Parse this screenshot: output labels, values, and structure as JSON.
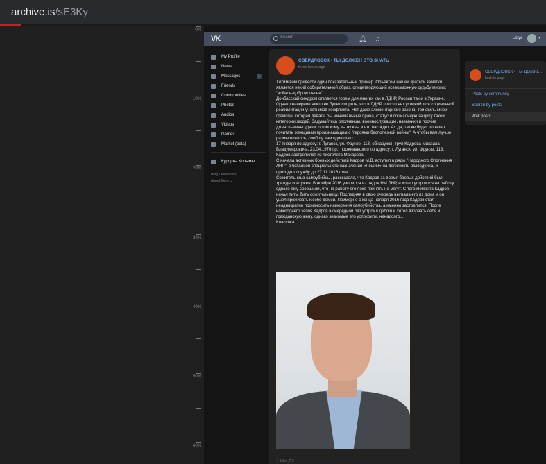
{
  "browser": {
    "url_host": "archive.is",
    "url_path": "/sE3Ky"
  },
  "ruler": {
    "labels": [
      "0%",
      "10%",
      "20%",
      "30%",
      "40%",
      "50%",
      "60%"
    ]
  },
  "vk": {
    "search_placeholder": "Search",
    "user_name": "Lidya",
    "sidebar": [
      {
        "label": "My Profile",
        "icon": "home-icon"
      },
      {
        "label": "News",
        "icon": "news-icon"
      },
      {
        "label": "Messages",
        "icon": "chat-icon",
        "badge": "1"
      },
      {
        "label": "Friends",
        "icon": "friends-icon"
      },
      {
        "label": "Communities",
        "icon": "communities-icon"
      },
      {
        "label": "Photos",
        "icon": "camera-icon"
      },
      {
        "label": "Audios",
        "icon": "music-icon"
      },
      {
        "label": "Videos",
        "icon": "video-icon"
      },
      {
        "label": "Games",
        "icon": "games-icon"
      },
      {
        "label": "Market (beta)",
        "icon": "shop-icon"
      }
    ],
    "sidebar_community": "Курорты Колымы",
    "sidebar_footer_1": "Blog   Developers",
    "sidebar_footer_2": "About   More ⌄",
    "post": {
      "author": "СВЕРДЛОВСК - ТЫ ДОЛЖЕН ЭТО ЗНАТЬ",
      "time": "three hours ago",
      "paragraphs": [
        "Хотим вам привести один показательный пример. Объектом нашей краткой заметки, является некий собирательный образ, олицетворяющий всевозможную судьбу многих \"войнов-добровольцев\".",
        "Донбасский синдром отзовется горем для многих как в ЛДНР, России так и в Украине. Однако наверное никто не будет спорить, что в ЛДНР просто нет условий для социальной реабилитации участников конфликта. Нет даже элементарного закона, той фильчиной грамоты, которая давала бы минимальные права, статус и социальную защиту такой категории людей. Задумайтесь ополченцы, военнослужащие, наемники и прочие джентльмены удачи, о том кому вы нужны и что вас ждет. Ах да, также будет полезно почитать женщинам произнашащим с \"героями бесполезной войны\". А чтобы вам лучше размышлялось, сообщу вам один факт:",
        "17 января по адресу: г. Луганск, ул. Фрунзе, 113, обнаружен труп Кадрова Михаила Владимировича, 23.04.1976 г.р., проживавшего по адресу: г. Луганск, ул. Фрунзе, 113.",
        "Кадров застрелился из пистолета Макарова.",
        "С начала активных боевых действий Кадров М.В. вступил в ряды \"Народного Ополчения ЛНР\", в батальон специального назначения «Леший» на должность разведчика, и проходил службу до 27.11.2016 года.",
        "Сожительница самоубийцы, рассказала, что Кадров за время боевых действий был трижды контужен. В ноябре 2016 уволился из рядов НМ ЛНР, и хотел устроится на работу, однако ему сообщили, что на работу его пока принять не могут. С того момента Кадров начал пить, бить сожительницу. Последняя в свою очередь выгнала его из дома и он ушел проживать к себе домой. Примерно с конца ноября 2016 года Кадров стал неоднократно произносить намерения самоубийства, а именно застрелится. После новогоднего запоя Кадров в очередной раз устроил дебош и хотел взорвать себя и гражданскую жену, однако знакомые его успокоили, ненадолго...",
        "Классика."
      ],
      "footer": "♡ Like   ⤴ 3"
    },
    "panel": {
      "title": "СВЕРДЛОВСК - ТЫ ДОЛЖЕН ЭТО ЗНАТЬ",
      "back": "back to page",
      "links": [
        "Posts by community",
        "Search by posts"
      ],
      "active": "Wall posts"
    }
  }
}
